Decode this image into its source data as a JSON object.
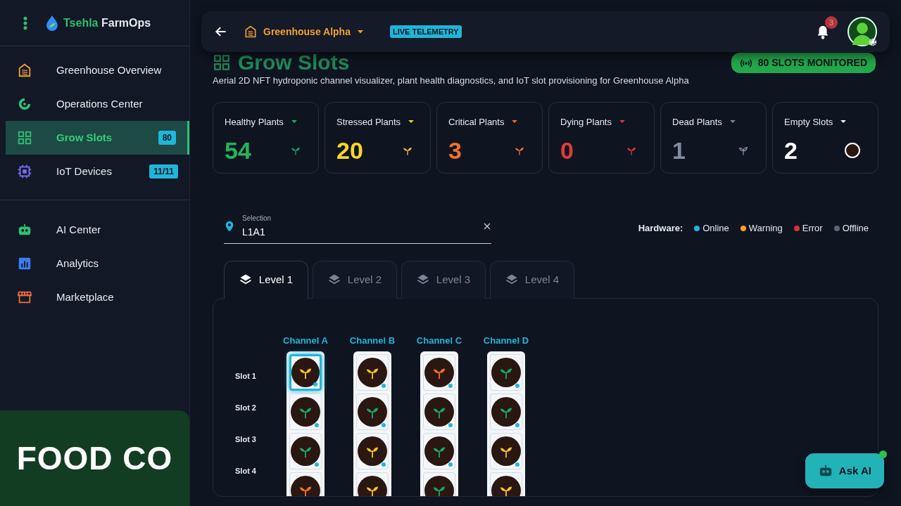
{
  "brand": {
    "part1": "Tsehla",
    "part2": "FarmOps"
  },
  "sidebar": {
    "groups": [
      [
        {
          "label": "Greenhouse Overview",
          "selected": false
        },
        {
          "label": "Operations Center",
          "selected": false
        },
        {
          "label": "Grow Slots",
          "selected": true,
          "badge": "80"
        },
        {
          "label": "IoT Devices",
          "selected": false,
          "badge": "11/11"
        }
      ],
      [
        {
          "label": "AI Center",
          "selected": false
        },
        {
          "label": "Analytics",
          "selected": false
        },
        {
          "label": "Marketplace",
          "selected": false
        }
      ]
    ],
    "sponsor": "FOOD CO"
  },
  "topbar": {
    "greenhouse": "Greenhouse Alpha",
    "live_badge": "LIVE TELEMETRY",
    "notifications": "3"
  },
  "header": {
    "title": "Grow Slots",
    "subtitle": "Aerial 2D NFT hydroponic channel visualizer, plant health diagnostics, and IoT slot provisioning for Greenhouse Alpha",
    "monitored": "80 SLOTS MONITORED"
  },
  "stats": [
    {
      "label": "Healthy Plants",
      "value": "54",
      "kind": "healthy"
    },
    {
      "label": "Stressed Plants",
      "value": "20",
      "kind": "stressed"
    },
    {
      "label": "Critical Plants",
      "value": "3",
      "kind": "critical"
    },
    {
      "label": "Dying Plants",
      "value": "0",
      "kind": "dying"
    },
    {
      "label": "Dead Plants",
      "value": "1",
      "kind": "dead"
    },
    {
      "label": "Empty Slots",
      "value": "2",
      "kind": "empty"
    }
  ],
  "selection": {
    "label": "Selection",
    "value": "L1A1"
  },
  "legend": {
    "title": "Hardware:",
    "items": [
      {
        "label": "Online",
        "color": "#1fb6d9"
      },
      {
        "label": "Warning",
        "color": "#f59e2b"
      },
      {
        "label": "Error",
        "color": "#dc2f2f"
      },
      {
        "label": "Offline",
        "color": "#5b6478"
      }
    ]
  },
  "tabs": [
    {
      "label": "Level 1",
      "selected": true
    },
    {
      "label": "Level 2",
      "selected": false
    },
    {
      "label": "Level 3",
      "selected": false
    },
    {
      "label": "Level 4",
      "selected": false
    }
  ],
  "grid": {
    "slot_labels": [
      "Slot 1",
      "Slot 2",
      "Slot 3",
      "Slot 4"
    ],
    "channels": [
      {
        "name": "Channel A",
        "slots": [
          {
            "kind": "stressed",
            "selected": true,
            "online": true
          },
          {
            "kind": "healthy",
            "selected": false,
            "online": true
          },
          {
            "kind": "healthy",
            "selected": false,
            "online": true
          },
          {
            "kind": "critical",
            "selected": false
          }
        ]
      },
      {
        "name": "Channel B",
        "slots": [
          {
            "kind": "stressed",
            "selected": false,
            "online": true
          },
          {
            "kind": "healthy",
            "selected": false,
            "online": true
          },
          {
            "kind": "stressed",
            "selected": false,
            "online": true
          },
          {
            "kind": "stressed",
            "selected": false
          }
        ]
      },
      {
        "name": "Channel C",
        "slots": [
          {
            "kind": "critical",
            "selected": false,
            "online": true
          },
          {
            "kind": "healthy",
            "selected": false,
            "online": true
          },
          {
            "kind": "healthy",
            "selected": false,
            "online": true
          },
          {
            "kind": "healthy",
            "selected": false
          }
        ]
      },
      {
        "name": "Channel D",
        "slots": [
          {
            "kind": "healthy",
            "selected": false,
            "online": true
          },
          {
            "kind": "healthy",
            "selected": false,
            "online": true
          },
          {
            "kind": "stressed",
            "selected": false,
            "online": true
          },
          {
            "kind": "stressed",
            "selected": false
          }
        ]
      }
    ]
  },
  "ask_ai": "Ask AI"
}
